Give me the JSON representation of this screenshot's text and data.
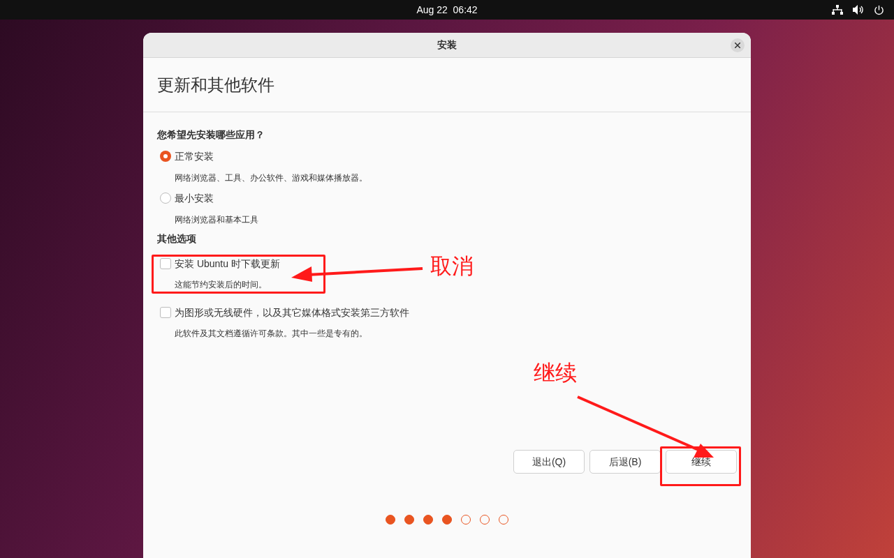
{
  "top_bar": {
    "clock": "Aug 22  06:42"
  },
  "window": {
    "title": "安装",
    "heading": "更新和其他软件"
  },
  "app_choice": {
    "question": "您希望先安装哪些应用？",
    "options": [
      {
        "label": "正常安装",
        "description": "网络浏览器、工具、办公软件、游戏和媒体播放器。",
        "selected": true
      },
      {
        "label": "最小安装",
        "description": "网络浏览器和基本工具",
        "selected": false
      }
    ]
  },
  "other_options": {
    "title": "其他选项",
    "items": [
      {
        "label": "安装 Ubuntu 时下载更新",
        "description": "这能节约安装后的时间。",
        "checked": false
      },
      {
        "label": "为图形或无线硬件，以及其它媒体格式安装第三方软件",
        "description": "此软件及其文档遵循许可条款。其中一些是专有的。",
        "checked": false
      }
    ]
  },
  "buttons": [
    {
      "label": "退出(Q)"
    },
    {
      "label": "后退(B)"
    },
    {
      "label": "继续"
    }
  ],
  "steps": [
    {
      "done": true
    },
    {
      "done": true
    },
    {
      "done": true
    },
    {
      "done": true
    },
    {
      "done": false
    },
    {
      "done": false
    },
    {
      "done": false
    }
  ],
  "annotations": [
    {
      "text": "取消"
    },
    {
      "text": "继续"
    }
  ]
}
